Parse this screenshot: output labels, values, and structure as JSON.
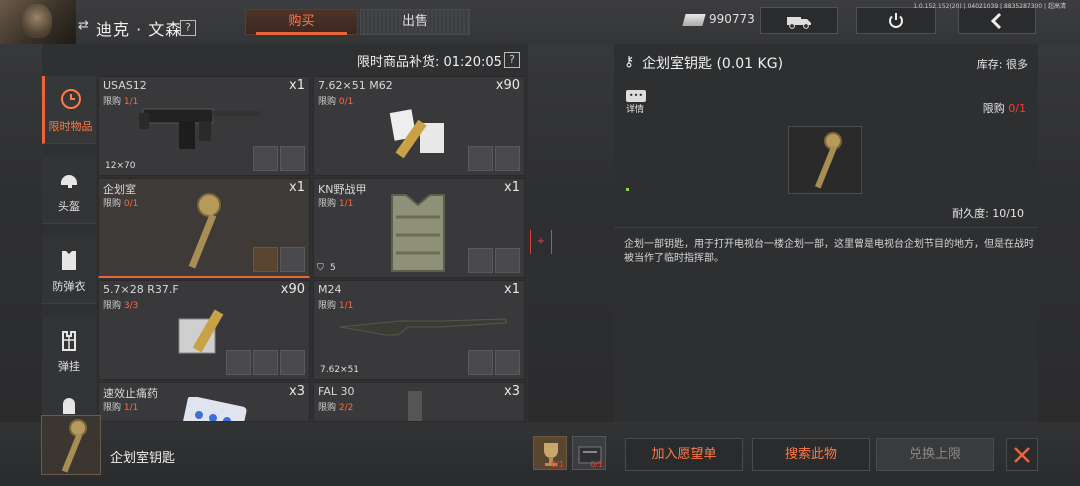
{
  "header": {
    "character_name": "迪克 · 文森",
    "help": "?",
    "tab_buy": "购买",
    "tab_sell": "出售",
    "money": "990773",
    "version": "1.0.152.152(20) | 04021039 | 8835287300 | 超高清"
  },
  "shop": {
    "restock_label": "限时商品补货: 01:20:05",
    "help": "?"
  },
  "categories": [
    {
      "label": "限时物品",
      "icon": "clock-icon"
    },
    {
      "label": "头盔",
      "icon": "helmet-icon"
    },
    {
      "label": "防弹衣",
      "icon": "vest-icon"
    },
    {
      "label": "弹挂",
      "icon": "rig-icon"
    },
    {
      "label": "",
      "icon": "bag-icon"
    }
  ],
  "items": [
    {
      "name": "USAS12",
      "limit_prefix": "限购 ",
      "limit": "1/1",
      "qty": "x1",
      "caliber": "12×70"
    },
    {
      "name": "7.62×51 M62",
      "limit_prefix": "限购 ",
      "limit": "0/1",
      "qty": "x90",
      "caliber": ""
    },
    {
      "name": "企划室",
      "limit_prefix": "限购 ",
      "limit": "0/1",
      "qty": "x1",
      "caliber": ""
    },
    {
      "name": "KN野战甲",
      "limit_prefix": "限购 ",
      "limit": "1/1",
      "qty": "x1",
      "caliber": "5"
    },
    {
      "name": "5.7×28 R37.F",
      "limit_prefix": "限购 ",
      "limit": "3/3",
      "qty": "x90",
      "caliber": ""
    },
    {
      "name": "M24",
      "limit_prefix": "限购 ",
      "limit": "1/1",
      "qty": "x1",
      "caliber": "7.62×51"
    },
    {
      "name": "速效止痛药",
      "limit_prefix": "限购 ",
      "limit": "1/1",
      "qty": "x3",
      "caliber": ""
    },
    {
      "name": "FAL 30",
      "limit_prefix": "限购 ",
      "limit": "2/2",
      "qty": "x3",
      "caliber": ""
    }
  ],
  "detail": {
    "title": "企划室钥匙 (0.01 KG)",
    "stock_label": "库存:  很多",
    "info_label": "详情",
    "limit_prefix": "限购 ",
    "limit": "0/1",
    "durability": "耐久度:  10/10",
    "description": "企划一部钥匙，用于打开电视台一楼企划一部，这里曾是电视台企划节目的地方，但是在战时被当作了临时指挥部。"
  },
  "footer": {
    "selected_name": "企划室钥匙",
    "cost1": "0/1",
    "cost2": "0/1",
    "wishlist": "加入愿望单",
    "search": "搜索此物",
    "exchange_limit": "兑换上限"
  },
  "colors": {
    "accent": "#e8663a",
    "limit_red": "#ff3b2f"
  }
}
